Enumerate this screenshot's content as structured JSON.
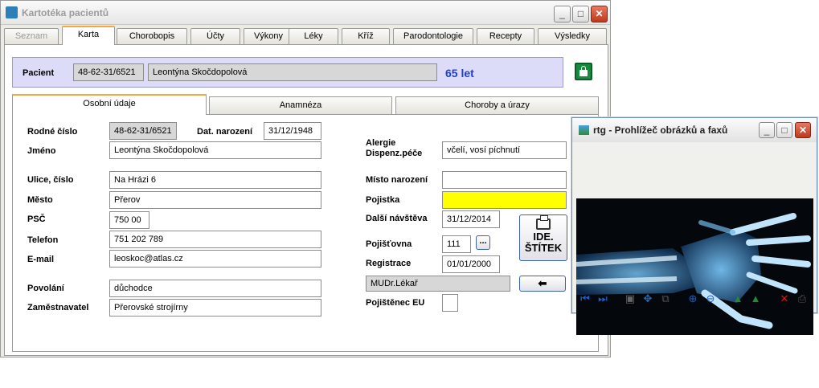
{
  "window": {
    "title": "Kartotéka pacientů"
  },
  "tabs": [
    "Seznam",
    "Karta",
    "Chorobopis",
    "Účty",
    "Výkony",
    "Léky",
    "Kříž",
    "Parodontologie",
    "Recepty",
    "Výsledky"
  ],
  "patient": {
    "label": "Pacient",
    "id": "48-62-31/6521",
    "name": "Leontýna Skočdopolová",
    "age": "65 let"
  },
  "subtabs": [
    "Osobní údaje",
    "Anamnéza",
    "Choroby a úrazy"
  ],
  "form": {
    "rodne_cislo": {
      "label": "Rodné číslo",
      "value": "48-62-31/6521"
    },
    "dat_narozeni": {
      "label": "Dat. narození",
      "value": "31/12/1948"
    },
    "jmeno": {
      "label": "Jméno",
      "value": "Leontýna Skočdopolová"
    },
    "ulice": {
      "label": "Ulice, číslo",
      "value": "Na Hrázi 6"
    },
    "mesto": {
      "label": "Město",
      "value": "Přerov"
    },
    "psc": {
      "label": "PSČ",
      "value": "750 00"
    },
    "telefon": {
      "label": "Telefon",
      "value": "751 202 789"
    },
    "email": {
      "label": "E-mail",
      "value": "leoskoc@atlas.cz"
    },
    "povolani": {
      "label": "Povolání",
      "value": "důchodce"
    },
    "zamestnavatel": {
      "label": "Zaměstnavatel",
      "value": "Přerovské strojírny"
    },
    "alergie": {
      "label": "Alergie\nDispenz.péče",
      "value": "včelí, vosí píchnutí"
    },
    "misto_narozeni": {
      "label": "Místo narození",
      "value": ""
    },
    "pojistka": {
      "label": "Pojistka",
      "value": ""
    },
    "dalsi_navsteva": {
      "label": "Další návštěva",
      "value": "31/12/2014"
    },
    "pojistovna": {
      "label": "Pojišťovna",
      "value": "111",
      "button": "..."
    },
    "registrace": {
      "label": "Registrace",
      "value": "01/01/2000"
    },
    "lekar": {
      "value": "MUDr.Lékař"
    },
    "pojistenec_eu": {
      "label": "Pojištěnec EU"
    },
    "ide_button": "IDE.\nŠTÍTEK"
  },
  "viewer": {
    "title": "rtg - Prohlížeč obrázků a faxů"
  }
}
